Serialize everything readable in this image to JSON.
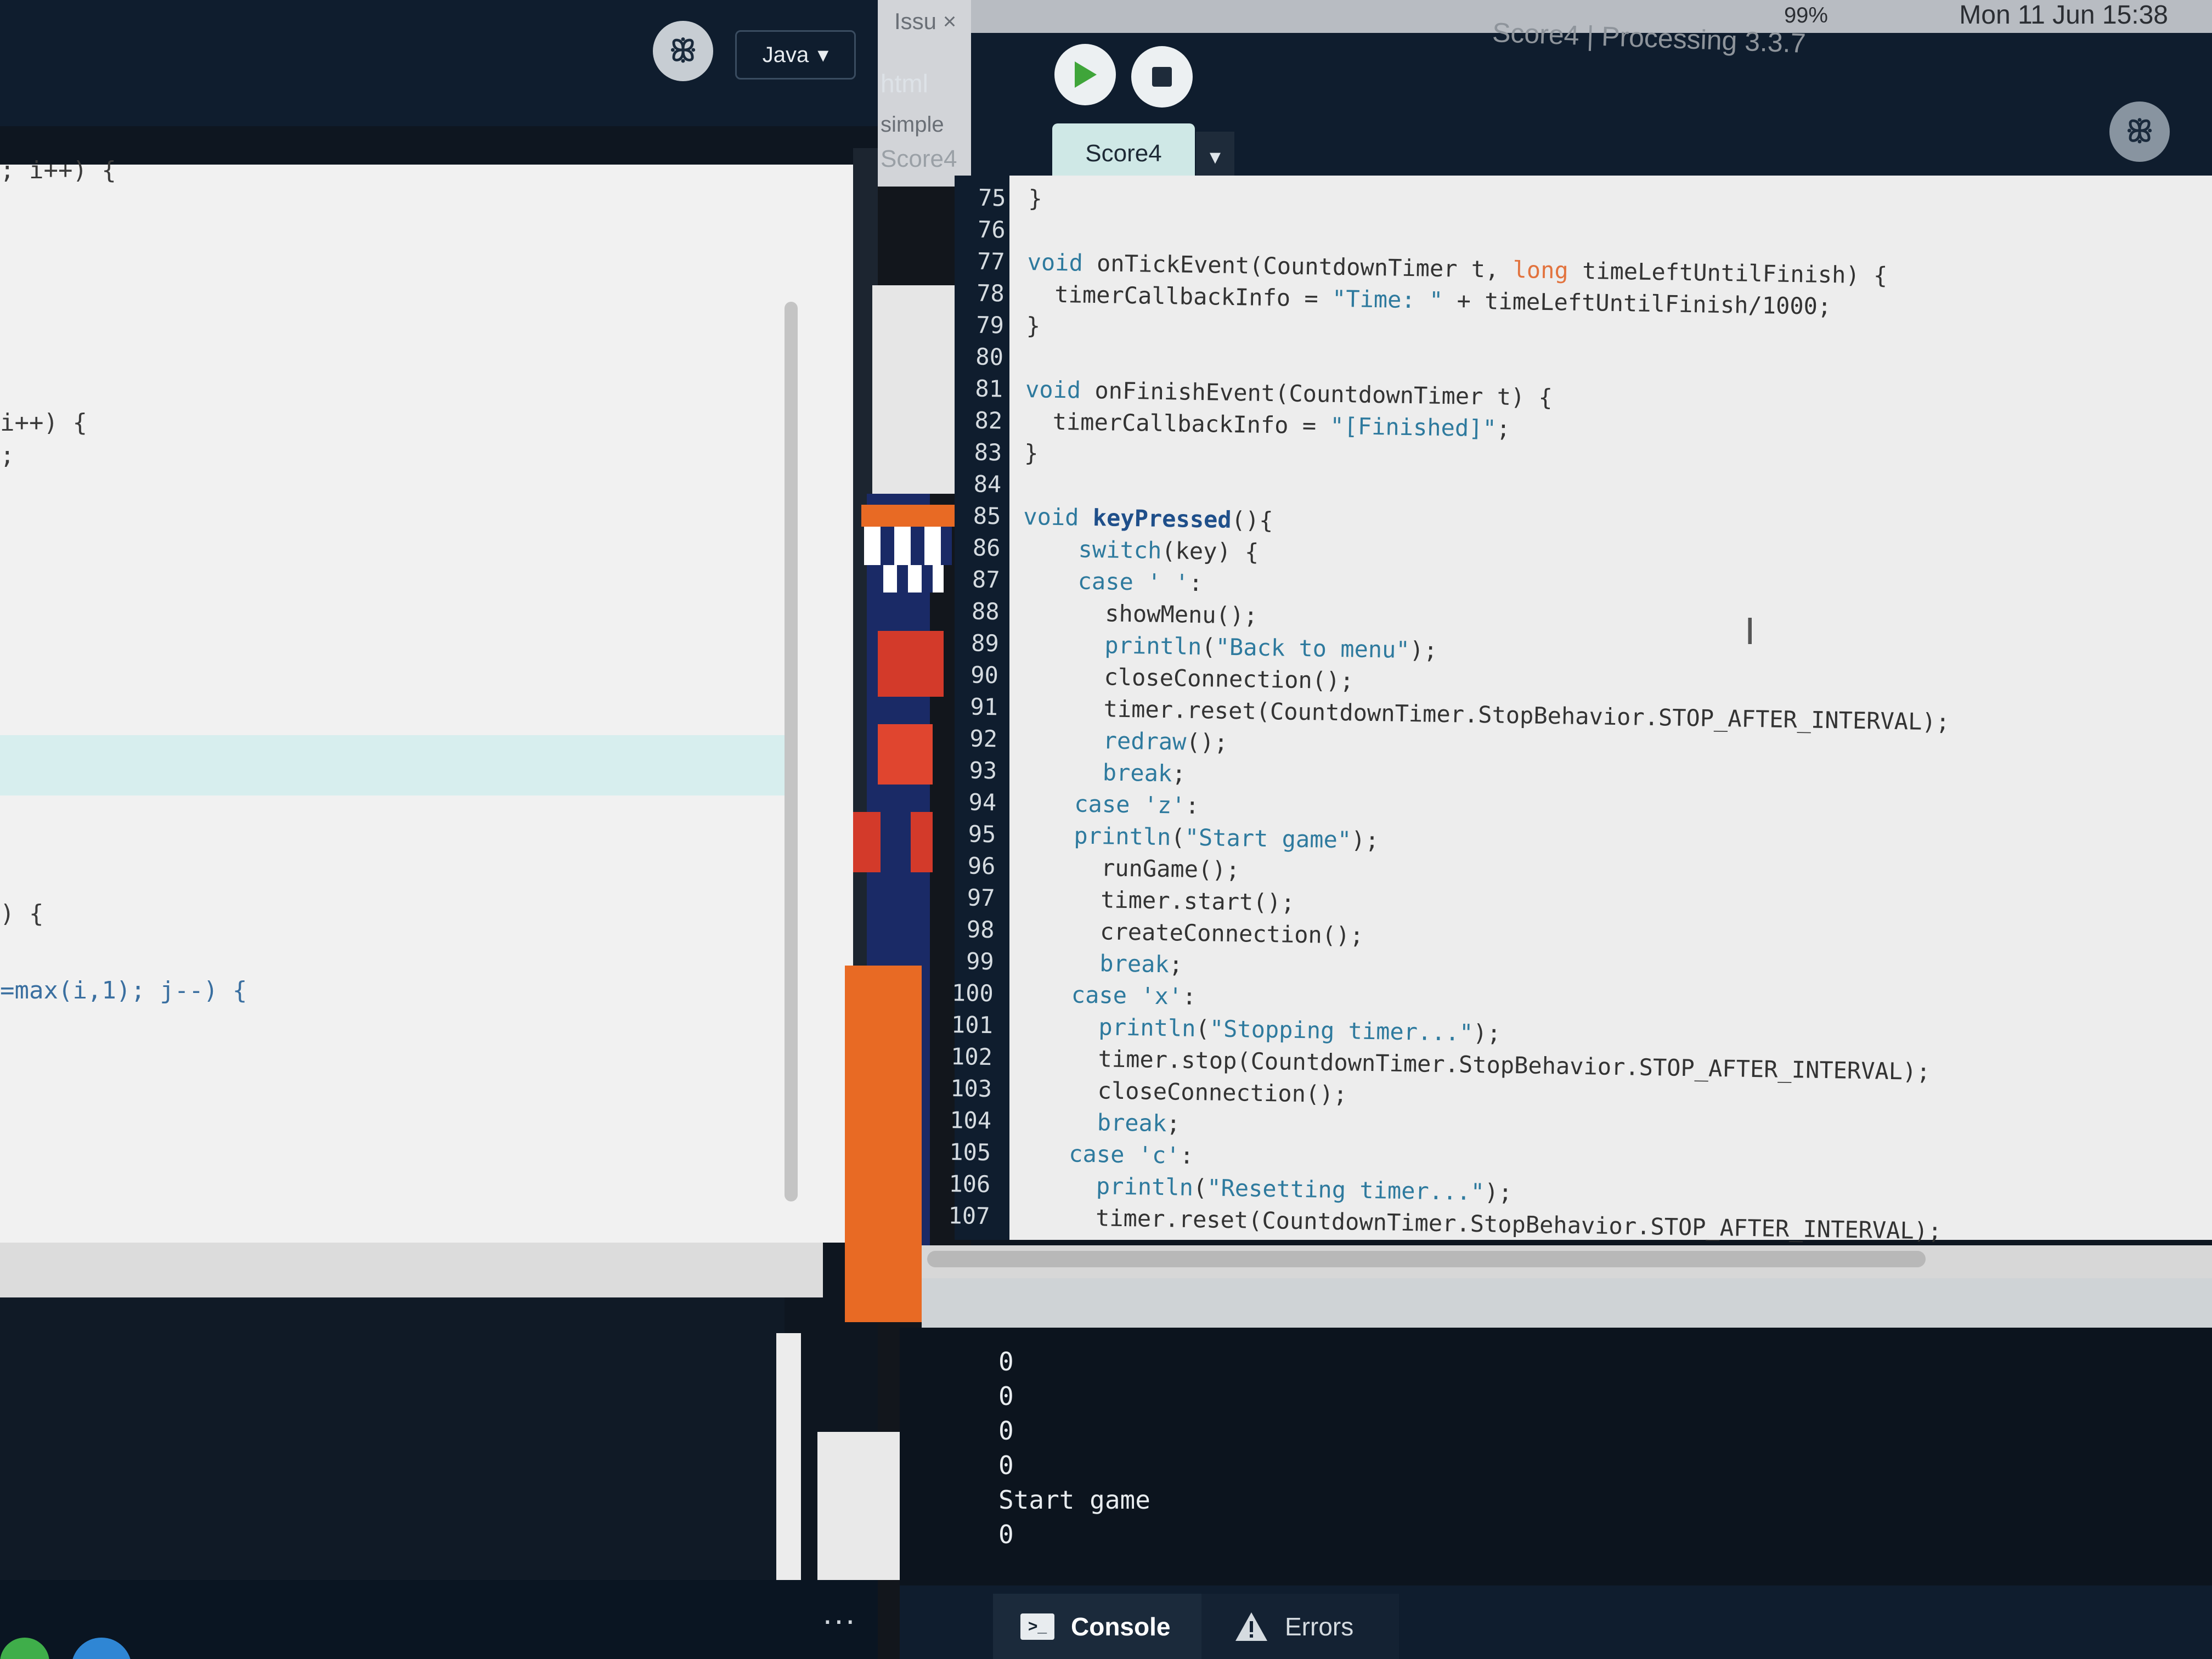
{
  "menubar": {
    "battery": "99%",
    "clock": "Mon 11 Jun 15:38"
  },
  "window_title": "Score4 | Processing 3.3.7",
  "left_window": {
    "mode_icon": "processing-mode-icon",
    "mode_label": "Java",
    "code_fragments": [
      "; i++) {",
      "i++) {",
      ";",
      ") {",
      "=max(i,1); j--) {"
    ],
    "menu_dots": "..."
  },
  "middle_window": {
    "tab_label": "Issu",
    "close_glyph": "×",
    "line1": "html",
    "line2": "simple",
    "line3": "Score4"
  },
  "toolbar": {
    "run_icon": "play-icon",
    "stop_icon": "stop-icon",
    "mode_icon": "processing-mode-icon"
  },
  "tab": {
    "label": "Score4",
    "dropdown": "▼"
  },
  "editor": {
    "lines": [
      {
        "n": "75",
        "text": "}"
      },
      {
        "n": "76",
        "text": ""
      },
      {
        "n": "77",
        "text": "void onTickEvent(CountdownTimer t, long timeLeftUntilFinish) {"
      },
      {
        "n": "78",
        "text": "  timerCallbackInfo = \"Time: \" + timeLeftUntilFinish/1000;"
      },
      {
        "n": "79",
        "text": "}"
      },
      {
        "n": "80",
        "text": ""
      },
      {
        "n": "81",
        "text": "void onFinishEvent(CountdownTimer t) {"
      },
      {
        "n": "82",
        "text": "  timerCallbackInfo = \"[Finished]\";"
      },
      {
        "n": "83",
        "text": "}"
      },
      {
        "n": "84",
        "text": ""
      },
      {
        "n": "85",
        "text": "void keyPressed(){"
      },
      {
        "n": "86",
        "text": "    switch(key) {"
      },
      {
        "n": "87",
        "text": "    case ' ':"
      },
      {
        "n": "88",
        "text": "      showMenu();"
      },
      {
        "n": "89",
        "text": "      println(\"Back to menu\");"
      },
      {
        "n": "90",
        "text": "      closeConnection();"
      },
      {
        "n": "91",
        "text": "      timer.reset(CountdownTimer.StopBehavior.STOP_AFTER_INTERVAL);"
      },
      {
        "n": "92",
        "text": "      redraw();"
      },
      {
        "n": "93",
        "text": "      break;"
      },
      {
        "n": "94",
        "text": "    case 'z':"
      },
      {
        "n": "95",
        "text": "    println(\"Start game\");"
      },
      {
        "n": "96",
        "text": "      runGame();"
      },
      {
        "n": "97",
        "text": "      timer.start();"
      },
      {
        "n": "98",
        "text": "      createConnection();"
      },
      {
        "n": "99",
        "text": "      break;"
      },
      {
        "n": "100",
        "text": "    case 'x':"
      },
      {
        "n": "101",
        "text": "      println(\"Stopping timer...\");"
      },
      {
        "n": "102",
        "text": "      timer.stop(CountdownTimer.StopBehavior.STOP_AFTER_INTERVAL);"
      },
      {
        "n": "103",
        "text": "      closeConnection();"
      },
      {
        "n": "104",
        "text": "      break;"
      },
      {
        "n": "105",
        "text": "    case 'c':"
      },
      {
        "n": "106",
        "text": "      println(\"Resetting timer...\");"
      },
      {
        "n": "107",
        "text": "      timer.reset(CountdownTimer.StopBehavior.STOP_AFTER_INTERVAL);"
      }
    ]
  },
  "console": {
    "lines": [
      "0",
      "0",
      "0",
      "0",
      "Start game",
      "0"
    ]
  },
  "footer": {
    "console_label": "Console",
    "console_icon": "terminal-icon",
    "errors_label": "Errors",
    "errors_icon": "warning-icon"
  },
  "colors": {
    "toolbar_bg": "#0f1d2e",
    "editor_bg": "#ededed",
    "tab_bg": "#cfe8e6",
    "keyword": "#2e7a9e",
    "accent_orange": "#e86a24"
  }
}
